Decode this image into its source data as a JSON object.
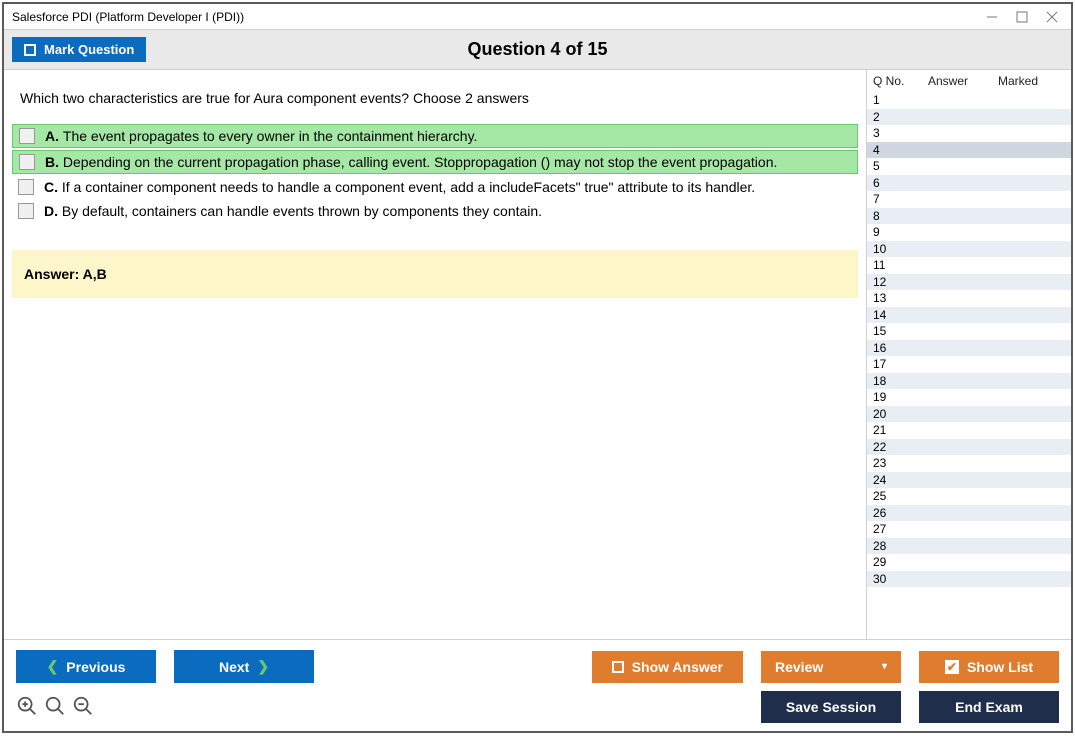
{
  "window": {
    "title": "Salesforce PDI (Platform Developer I (PDI))"
  },
  "header": {
    "mark_label": "Mark Question",
    "question_title": "Question 4 of 15"
  },
  "question": {
    "text": "Which two characteristics are true for Aura component events? Choose 2 answers",
    "options": [
      {
        "letter": "A.",
        "text": "The event propagates to every owner in the containment hierarchy.",
        "correct": true
      },
      {
        "letter": "B.",
        "text": "Depending on the current propagation phase, calling event. Stoppropagation () may not stop the event propagation.",
        "correct": true
      },
      {
        "letter": "C.",
        "text": "If a container component needs to handle a component event, add a includeFacets\" true\" attribute to its handler.",
        "correct": false
      },
      {
        "letter": "D.",
        "text": "By default, containers can handle events thrown by components they contain.",
        "correct": false
      }
    ],
    "answer_label": "Answer: A,B"
  },
  "sidebar": {
    "col_qno": "Q No.",
    "col_answer": "Answer",
    "col_marked": "Marked",
    "rows": [
      {
        "n": "1"
      },
      {
        "n": "2"
      },
      {
        "n": "3"
      },
      {
        "n": "4",
        "selected": true
      },
      {
        "n": "5"
      },
      {
        "n": "6"
      },
      {
        "n": "7"
      },
      {
        "n": "8"
      },
      {
        "n": "9"
      },
      {
        "n": "10"
      },
      {
        "n": "11"
      },
      {
        "n": "12"
      },
      {
        "n": "13"
      },
      {
        "n": "14"
      },
      {
        "n": "15"
      },
      {
        "n": "16"
      },
      {
        "n": "17"
      },
      {
        "n": "18"
      },
      {
        "n": "19"
      },
      {
        "n": "20"
      },
      {
        "n": "21"
      },
      {
        "n": "22"
      },
      {
        "n": "23"
      },
      {
        "n": "24"
      },
      {
        "n": "25"
      },
      {
        "n": "26"
      },
      {
        "n": "27"
      },
      {
        "n": "28"
      },
      {
        "n": "29"
      },
      {
        "n": "30"
      }
    ]
  },
  "footer": {
    "previous": "Previous",
    "next": "Next",
    "show_answer": "Show Answer",
    "review": "Review",
    "show_list": "Show List",
    "save_session": "Save Session",
    "end_exam": "End Exam"
  }
}
